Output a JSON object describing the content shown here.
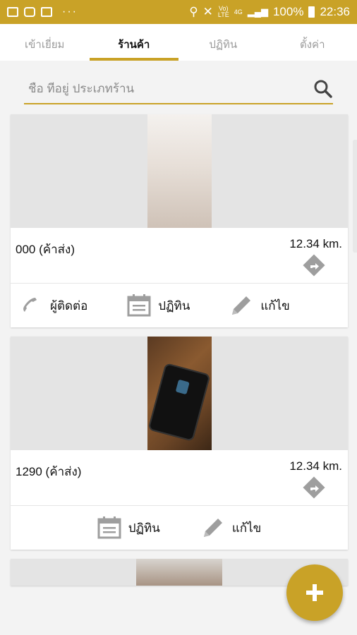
{
  "status_bar": {
    "battery": "100%",
    "time": "22:36",
    "volte": "Vo))\nLTE",
    "net": "4G"
  },
  "tabs": [
    {
      "label": "เข้าเยี่ยม"
    },
    {
      "label": "ร้านค้า"
    },
    {
      "label": "ปฏิทิน"
    },
    {
      "label": "ตั้งค่า"
    }
  ],
  "search": {
    "placeholder": "ชื่อ ที่อยู่ ประเภทร้าน"
  },
  "stores": [
    {
      "name": "000 (ค้าส่ง)",
      "distance": "12.34 km.",
      "actions": {
        "contact": "ผู้ติดต่อ",
        "calendar": "ปฏิทิน",
        "edit": "แก้ไข"
      }
    },
    {
      "name": "1290 (ค้าส่ง)",
      "distance": "12.34 km.",
      "actions": {
        "calendar": "ปฏิทิน",
        "edit": "แก้ไข"
      }
    }
  ],
  "colors": {
    "accent": "#c9a227",
    "icon_gray": "#9e9e9e"
  }
}
